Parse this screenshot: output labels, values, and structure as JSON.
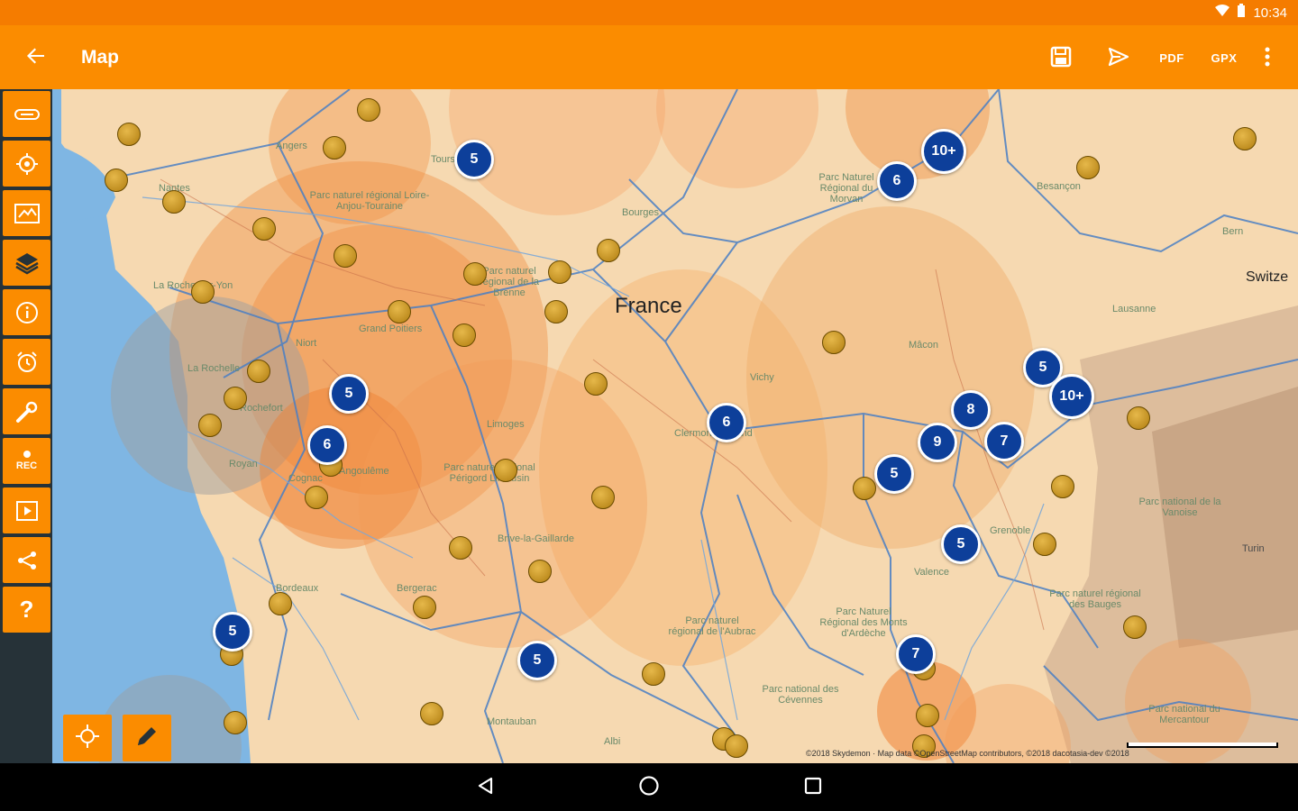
{
  "status_bar": {
    "time": "10:34"
  },
  "app_bar": {
    "title": "Map",
    "actions": {
      "pdf": "PDF",
      "gpx": "GPX"
    }
  },
  "toolbar": {
    "record_label": "REC"
  },
  "map": {
    "country_label": "France",
    "side_label": "Switze",
    "labels": [
      "Angers",
      "Nantes",
      "Tours",
      "Bourges",
      "Parc Naturel Régional du Morvan",
      "Besançon",
      "Parc naturel régional Loire-Anjou-Touraine",
      "Parc naturel régional de la Brenne",
      "La Roche-sur-Yon",
      "Grand Poitiers",
      "Niort",
      "La Rochelle",
      "Rochefort",
      "Limoges",
      "Parc naturel régional Périgord Limousin",
      "Clermont-Ferrand",
      "Vichy",
      "Mâcon",
      "Lausanne",
      "Bern",
      "Royan",
      "Cognac",
      "Angoulême",
      "Brive-la-Gaillarde",
      "Bordeaux",
      "Bergerac",
      "Montauban",
      "Valence",
      "Parc naturel régional de l'Aubrac",
      "Parc Naturel Régional des Monts d'Ardèche",
      "Parc national des Cévennes",
      "Parc naturel régional des Bauges",
      "Parc national de la Vanoise",
      "Turin",
      "Parc national du Mercantour",
      "Albi",
      "Grenoble"
    ],
    "clusters": [
      "5",
      "10+",
      "6",
      "5",
      "6",
      "6",
      "5",
      "10+",
      "8",
      "9",
      "7",
      "5",
      "5",
      "5",
      "5",
      "7"
    ],
    "copyright": "©2018 Skydemon · Map data ©OpenStreetMap contributors, ©2018 dacotasia-dev ©2018"
  },
  "colors": {
    "status_bar": "#f57c00",
    "app_bar": "#fb8c00",
    "toolbar_bg": "#263238",
    "cluster": "#0d3f9a"
  },
  "icons": {
    "back": "arrow-left-icon",
    "save": "save-icon",
    "send": "send-icon",
    "more": "more-vert-icon"
  }
}
